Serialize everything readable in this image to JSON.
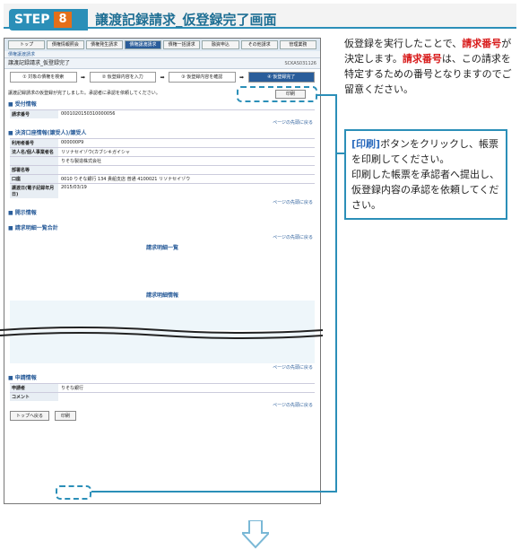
{
  "header": {
    "step_label": "STEP",
    "step_number": "8",
    "title": "譲渡記録請求_仮登録完了画面"
  },
  "tabs": [
    "トップ",
    "債権情報照会",
    "債権発生請求",
    "債権譲渡請求",
    "債権一括請求",
    "融資申込",
    "その他請求",
    "管理業務"
  ],
  "subnav": "債権譲渡請求",
  "screen": {
    "title": "譲渡記録請求_仮登録完了",
    "screen_id": "SCKAS031126",
    "print_label": "印刷",
    "steps": [
      "① 対象の債権を検索",
      "② 仮登録内容を入力",
      "③ 仮登録内容を確認",
      "④ 仮登録完了"
    ],
    "message": "譲渡記録請求の仮登録が完了しました。承認者に承認を依頼してください。",
    "sec1": "■ 受付情報",
    "req_label": "請求番号",
    "req_value": "0001020150310000056",
    "link": "ページの先頭に戻る",
    "sec2": "■ 決済口座情報(譲受人)/譲受人",
    "rows": [
      [
        "利用者番号",
        "000000P9"
      ],
      [
        "法人名/個人事業者名",
        "リソナセイゾウ(カブシキガイシャ"
      ],
      [
        "",
        "りそな製造株式会社"
      ],
      [
        "部署名等",
        ""
      ],
      [
        "口座",
        "0010 りそな銀行 134 貴船支店 普通 4100021 リソナセイゾウ"
      ],
      [
        "譲渡日(電子記録年月日)",
        "2015/03/19"
      ]
    ],
    "sec3": "■ 開示情報",
    "sec4": "■ 請求明細一覧合計",
    "sec5": "■ 申請情報",
    "list_title": "請求明細一覧",
    "detail_sec": "請求明細情報",
    "apply_rows": [
      [
        "申請者",
        "りそな銀行"
      ],
      [
        "コメント",
        ""
      ]
    ],
    "back_label": "トップへ戻る"
  },
  "explain": {
    "t1": "仮登録を実行したことで、",
    "t2": "請求番号",
    "t3": "が決定します。",
    "t4": "請求番号",
    "t5": "は、この請求を特定するための番号となりますのでご留意ください。"
  },
  "box": {
    "b1": "[印刷]",
    "b2": "ボタンをクリックし、帳票を印刷してください。",
    "b3": "印刷した帳票を承認者へ提出し、仮登録内容の承認を依頼してください。"
  }
}
